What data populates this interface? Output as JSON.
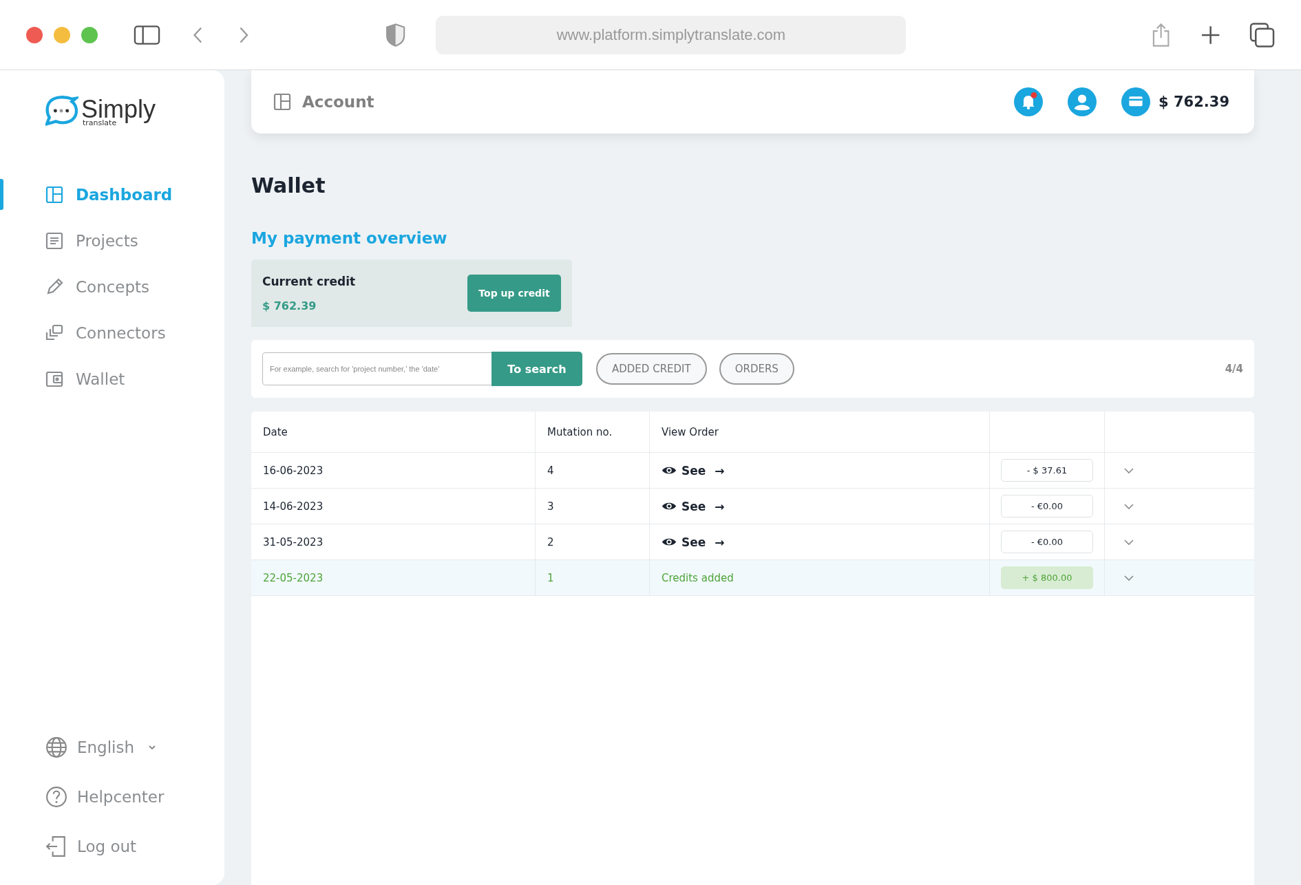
{
  "browser": {
    "url": "www.platform.simplytranslate.com"
  },
  "sidebar": {
    "logo": {
      "name": "Simply",
      "tagline": "translate"
    },
    "items": [
      {
        "label": "Dashboard",
        "selected": true
      },
      {
        "label": "Projects",
        "selected": false
      },
      {
        "label": "Concepts",
        "selected": false
      },
      {
        "label": "Connectors",
        "selected": false
      },
      {
        "label": "Wallet",
        "selected": false
      }
    ],
    "language": "English",
    "help": "Helpcenter",
    "logout": "Log out"
  },
  "header": {
    "title": "Account",
    "notification": true,
    "balance": "$ 762.39"
  },
  "page": {
    "title": "Wallet",
    "subtitle": "My payment overview"
  },
  "credit": {
    "label": "Current credit",
    "amount": "$ 762.39",
    "button": "Top up credit"
  },
  "search": {
    "placeholder": "For example, search for 'project number,' the 'date'",
    "button": "To search",
    "filters": [
      "ADDED CREDIT",
      "ORDERS"
    ],
    "count": "4/4"
  },
  "table": {
    "columns": [
      "Date",
      "Mutation no.",
      "View Order"
    ],
    "rows": [
      {
        "kind": "order",
        "date": "16-06-2023",
        "number": "4",
        "view": "See",
        "arrow": "→",
        "amount": "- $ 37.61"
      },
      {
        "kind": "order",
        "date": "14-06-2023",
        "number": "3",
        "view": "See",
        "arrow": "→",
        "amount": "- €0.00"
      },
      {
        "kind": "order",
        "date": "31-05-2023",
        "number": "2",
        "view": "See",
        "arrow": "→",
        "amount": "- €0.00"
      },
      {
        "kind": "credit",
        "date": "22-05-2023",
        "number": "1",
        "view": "Credits added",
        "amount": "+ $ 800.00"
      }
    ]
  }
}
